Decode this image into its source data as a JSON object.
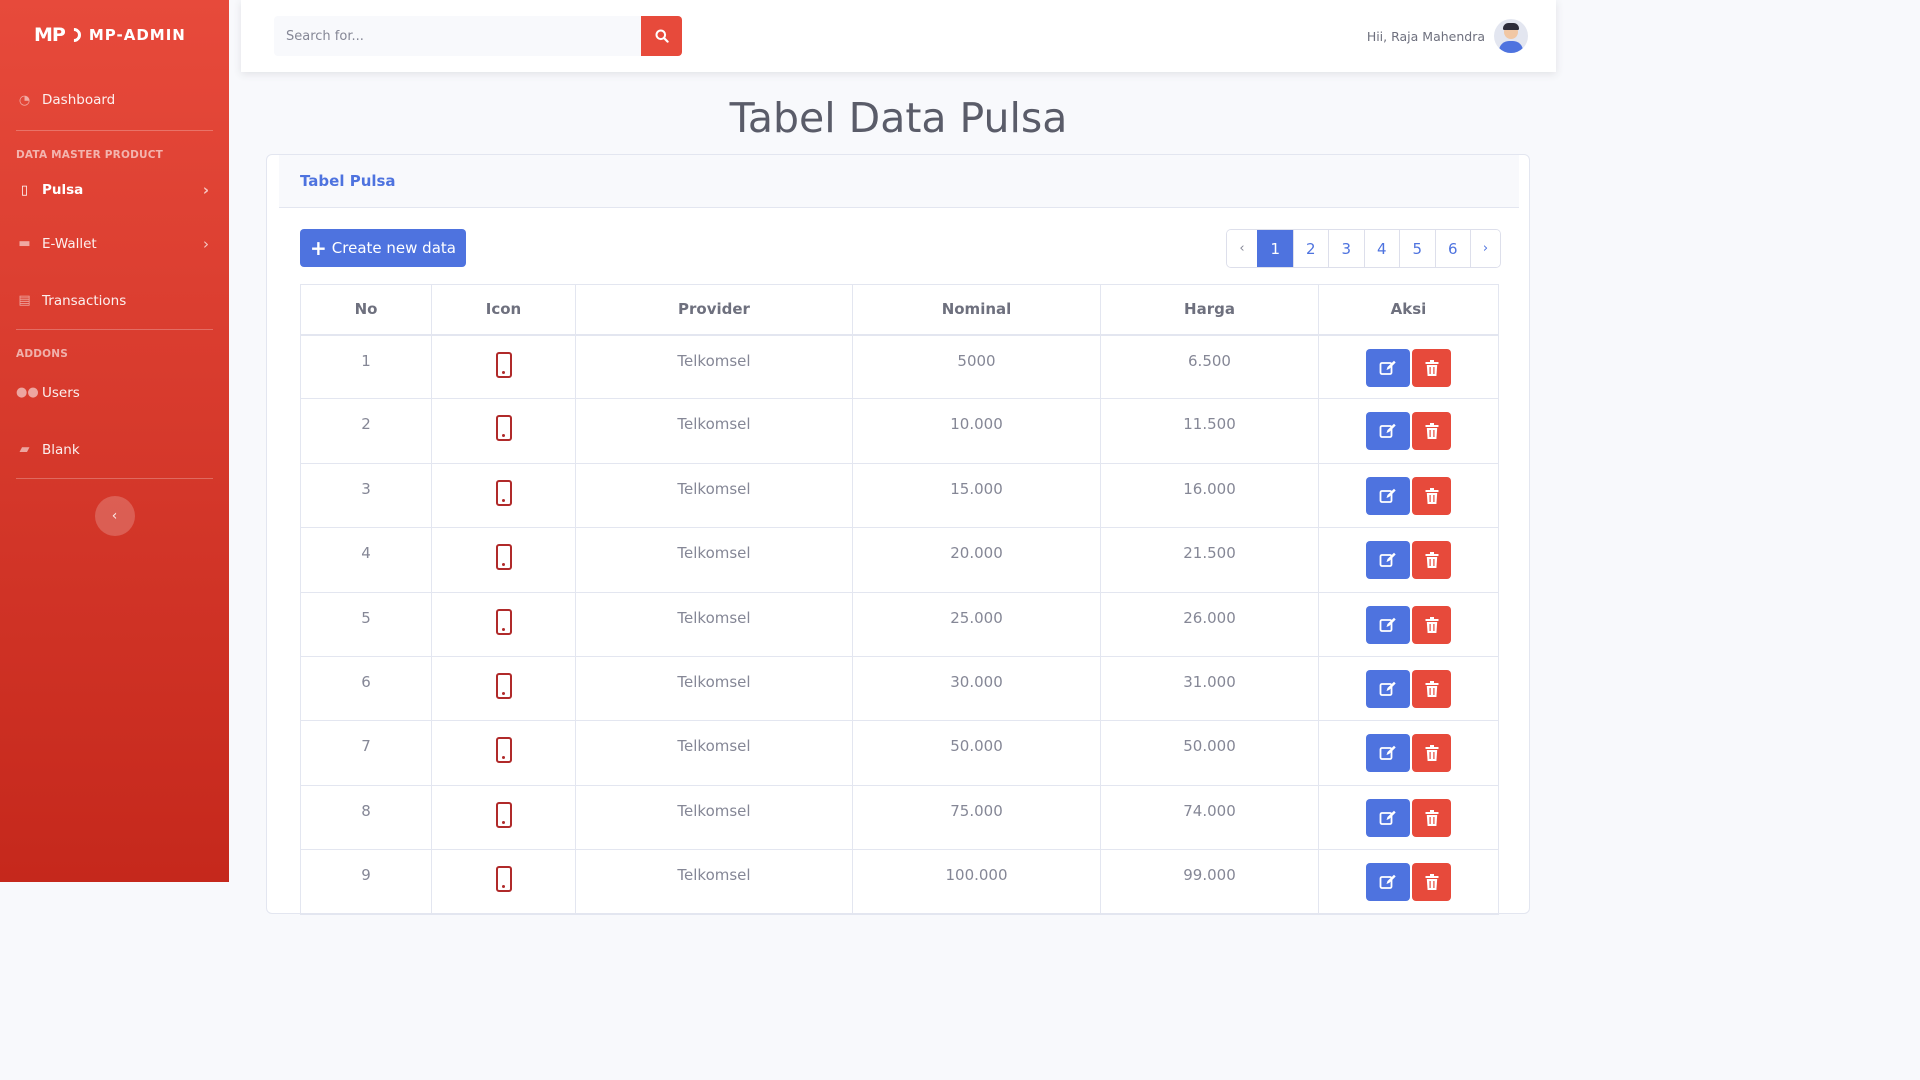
{
  "brand": {
    "logo": "MP",
    "name": "MP-ADMIN"
  },
  "sidebar": {
    "dashboard": "Dashboard",
    "heading_master": "DATA MASTER PRODUCT",
    "pulsa": "Pulsa",
    "ewallet": "E-Wallet",
    "transactions": "Transactions",
    "heading_addons": "ADDONS",
    "users": "Users",
    "blank": "Blank"
  },
  "topbar": {
    "search_placeholder": "Search for...",
    "user_greeting": "Hii, Raja Mahendra"
  },
  "page_title": "Tabel Data Pulsa",
  "card": {
    "title": "Tabel Pulsa",
    "create_label": "Create new data"
  },
  "pagination": {
    "prev": "‹",
    "pages": [
      "1",
      "2",
      "3",
      "4",
      "5",
      "6"
    ],
    "next": "›",
    "active": "1"
  },
  "table": {
    "headers": [
      "No",
      "Icon",
      "Provider",
      "Nominal",
      "Harga",
      "Aksi"
    ],
    "rows": [
      {
        "no": "1",
        "provider": "Telkomsel",
        "nominal": "5000",
        "harga": "6.500"
      },
      {
        "no": "2",
        "provider": "Telkomsel",
        "nominal": "10.000",
        "harga": "11.500"
      },
      {
        "no": "3",
        "provider": "Telkomsel",
        "nominal": "15.000",
        "harga": "16.000"
      },
      {
        "no": "4",
        "provider": "Telkomsel",
        "nominal": "20.000",
        "harga": "21.500"
      },
      {
        "no": "5",
        "provider": "Telkomsel",
        "nominal": "25.000",
        "harga": "26.000"
      },
      {
        "no": "6",
        "provider": "Telkomsel",
        "nominal": "30.000",
        "harga": "31.000"
      },
      {
        "no": "7",
        "provider": "Telkomsel",
        "nominal": "50.000",
        "harga": "50.000"
      },
      {
        "no": "8",
        "provider": "Telkomsel",
        "nominal": "75.000",
        "harga": "74.000"
      },
      {
        "no": "9",
        "provider": "Telkomsel",
        "nominal": "100.000",
        "harga": "99.000"
      }
    ]
  },
  "colors": {
    "primary": "#4e73df",
    "danger": "#e74a3b",
    "sidebar_dark": "#c5281c"
  }
}
